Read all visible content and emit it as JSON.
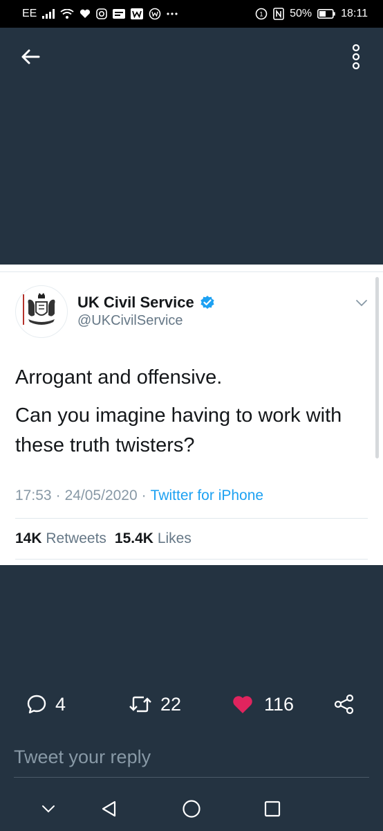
{
  "status_bar": {
    "carrier": "EE",
    "battery": "50%",
    "time": "18:11",
    "icons": [
      "signal-icon",
      "wifi-icon",
      "heart-monitor-icon",
      "instagram-icon",
      "news-icon",
      "whatsapp-icon",
      "more-dots-icon",
      "nfc-icon",
      "battery-icon"
    ]
  },
  "app_bar": {
    "back_icon": "arrow-left-icon",
    "more_icon": "vertical-dots-icon"
  },
  "tweet": {
    "display_name": "UK Civil Service",
    "handle": "@UKCivilService",
    "verified": true,
    "text_lines": [
      "Arrogant and offensive.",
      "Can you imagine having to work with these truth twisters?"
    ],
    "time": "17:53",
    "date": "24/05/2020",
    "separator": "·",
    "source": "Twitter for iPhone",
    "retweets_count": "14K",
    "retweets_label": "Retweets",
    "likes_count": "15.4K",
    "likes_label": "Likes"
  },
  "actions": {
    "reply_count": "4",
    "retweet_count": "22",
    "like_count": "116",
    "liked": true
  },
  "reply": {
    "placeholder": "Tweet your reply"
  },
  "nav": {
    "icons": [
      "chevron-down-icon",
      "back-triangle-icon",
      "home-circle-icon",
      "recents-square-icon"
    ]
  },
  "colors": {
    "background": "#243341",
    "accent": "#1da1f2",
    "like": "#e0245e",
    "meta": "#8899a6"
  }
}
